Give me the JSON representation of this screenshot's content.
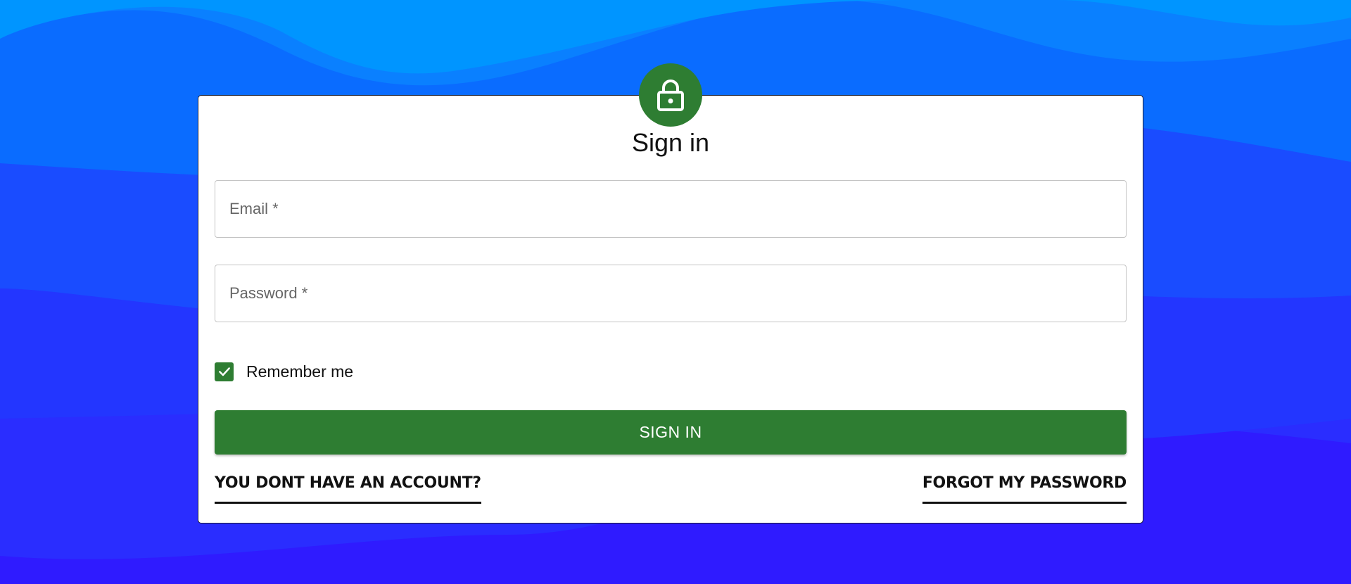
{
  "login": {
    "title": "Sign in",
    "email_placeholder": "Email *",
    "password_placeholder": "Password *",
    "remember_label": "Remember me",
    "remember_checked": true,
    "submit_label": "SIGN IN",
    "signup_link": "YOU DONT HAVE AN ACCOUNT?",
    "forgot_link": "FORGOT MY PASSWORD"
  },
  "icons": {
    "badge": "lock-icon",
    "checkbox": "check-icon"
  },
  "colors": {
    "accent": "#2e7d32",
    "background_top": "#0095ff",
    "background_bottom": "#2f1bff",
    "card": "#ffffff"
  }
}
